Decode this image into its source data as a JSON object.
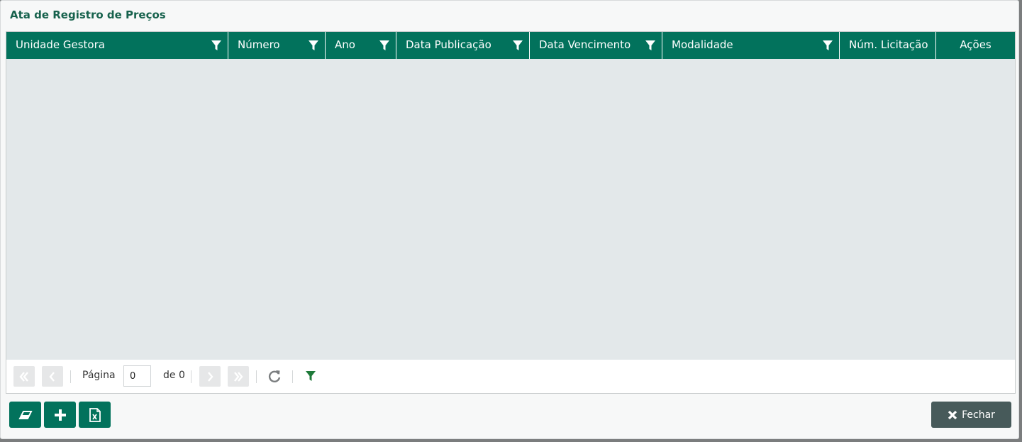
{
  "window": {
    "title": "Ata de Registro de Preços"
  },
  "grid": {
    "columns": [
      {
        "label": "Unidade Gestora",
        "filter": true
      },
      {
        "label": "Número",
        "filter": true
      },
      {
        "label": "Ano",
        "filter": true
      },
      {
        "label": "Data Publicação",
        "filter": true
      },
      {
        "label": "Data Vencimento",
        "filter": true
      },
      {
        "label": "Modalidade",
        "filter": true
      },
      {
        "label": "Núm. Licitação",
        "filter": false
      },
      {
        "label": "Ações",
        "filter": false
      }
    ],
    "rows": []
  },
  "pager": {
    "page_label": "Página",
    "page_value": "0",
    "of_label": "de 0"
  },
  "toolbar": {
    "close_label": "Fechar"
  },
  "colors": {
    "accent": "#02725c",
    "title": "#17624d",
    "grid_body": "#e3e8ea",
    "close_button": "#475a5a"
  }
}
